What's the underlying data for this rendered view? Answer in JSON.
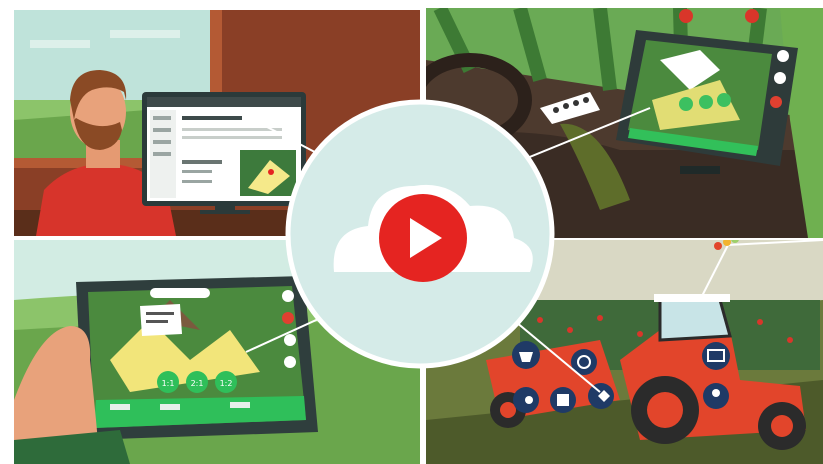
{
  "video": {
    "play_icon": "youtube-play-icon",
    "accent": "#e52421"
  },
  "panels": [
    {
      "id": "office",
      "icon": "desktop-monitor"
    },
    {
      "id": "cab",
      "icon": "cab-terminal"
    },
    {
      "id": "field-tablet",
      "icon": "handheld-tablet"
    },
    {
      "id": "tractor",
      "icon": "tractor-implement"
    }
  ],
  "tablet_screen": {
    "badges": [
      "1:1",
      "2:1",
      "1:2"
    ]
  },
  "implement_icons": [
    "basket-icon",
    "gauge-icon",
    "gear-arrow-icon",
    "chip-icon",
    "signal-diamond-icon"
  ],
  "tractor_icons": [
    "monitor-icon",
    "location-pin-icon"
  ],
  "colors": {
    "field_green": "#6fa84a",
    "cloud_circle": "#cfe6e4",
    "tractor_red": "#e2452b",
    "navy_icon": "#1f3a66"
  }
}
